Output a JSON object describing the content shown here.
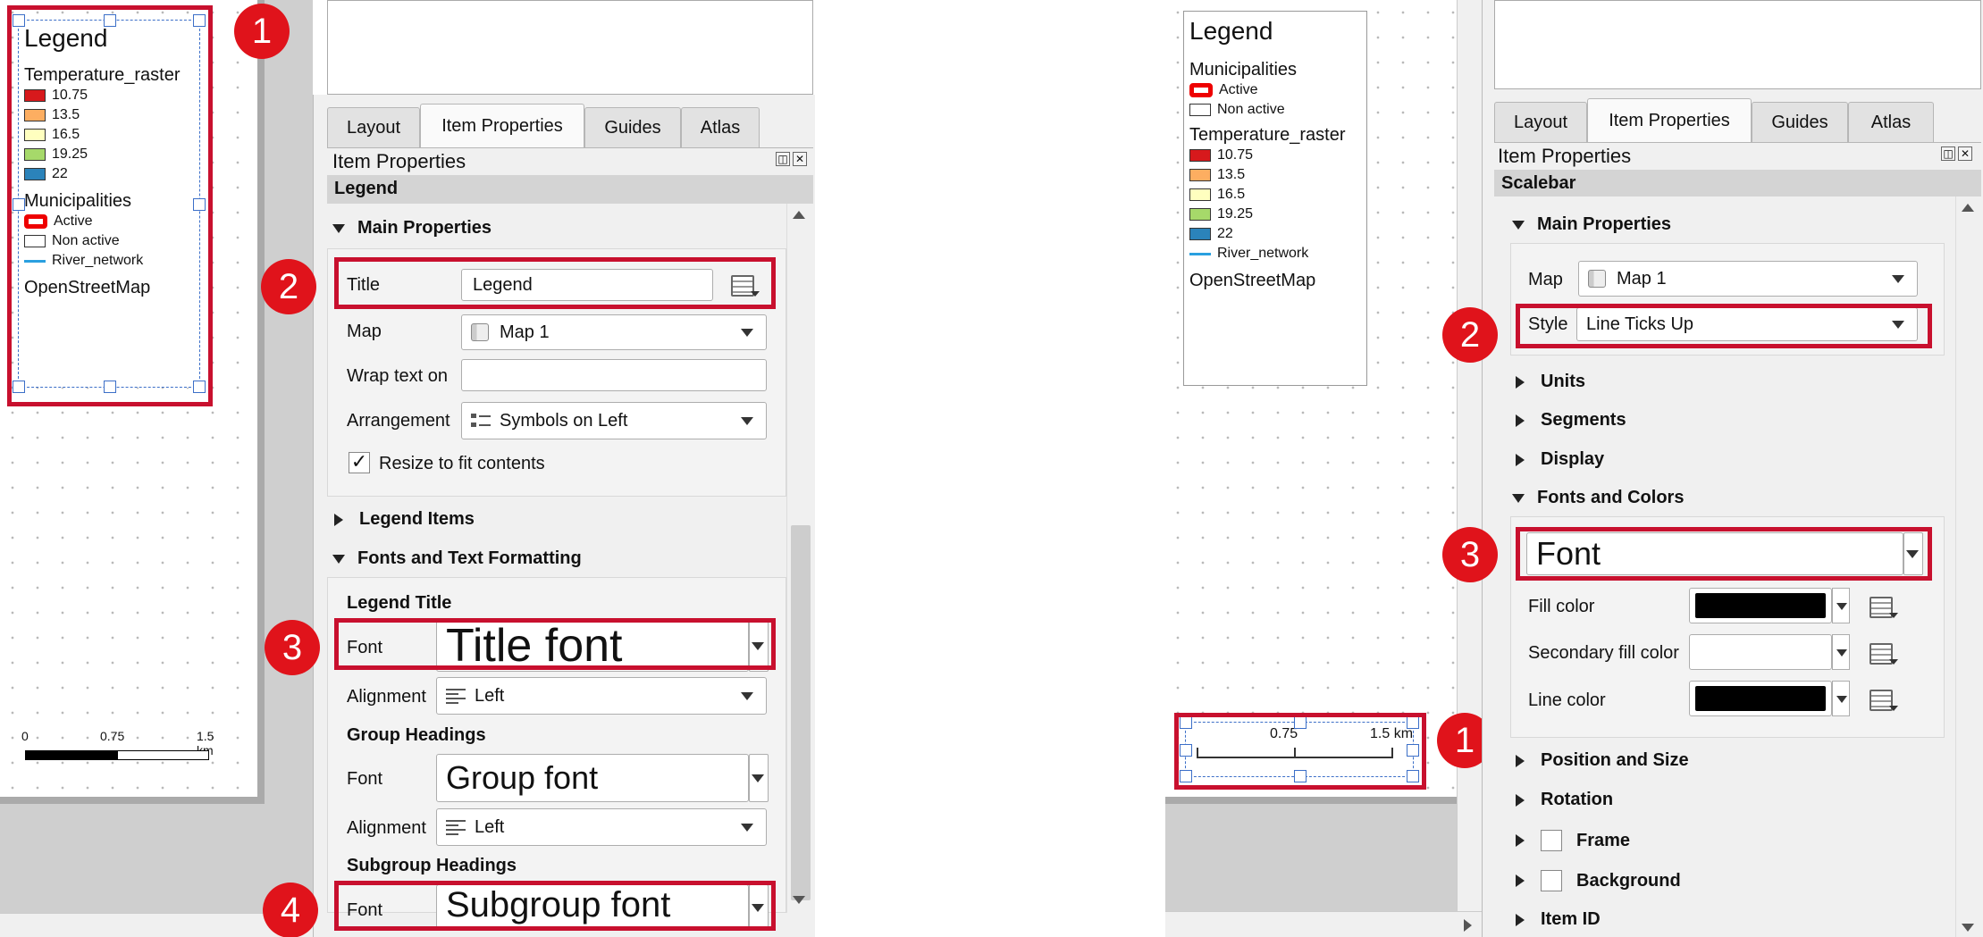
{
  "left": {
    "legend": {
      "title": "Legend",
      "groups": [
        {
          "name": "Temperature_raster",
          "items": [
            {
              "label": "10.75",
              "color": "#d7191c"
            },
            {
              "label": "13.5",
              "color": "#fdae61"
            },
            {
              "label": "16.5",
              "color": "#ffffbf"
            },
            {
              "label": "19.25",
              "color": "#a6d96a"
            },
            {
              "label": "22",
              "color": "#2b83ba"
            }
          ]
        },
        {
          "name": "Municipalities",
          "items": [
            {
              "label": "Active",
              "style": "active"
            },
            {
              "label": "Non active",
              "style": "plain"
            },
            {
              "label": "River_network",
              "style": "line"
            }
          ]
        },
        {
          "name": "OpenStreetMap",
          "items": []
        }
      ]
    },
    "scalebar": {
      "ticks": [
        "0",
        "0.75",
        "1.5 km"
      ]
    },
    "tabs": [
      "Layout",
      "Item Properties",
      "Guides",
      "Atlas"
    ],
    "active_tab": "Item Properties",
    "panel_title": "Item Properties",
    "item_type": "Legend",
    "main_properties": "Main Properties",
    "title_label": "Title",
    "title_value": "Legend",
    "map_label": "Map",
    "map_value": "Map 1",
    "wrap_label": "Wrap text on",
    "wrap_value": "",
    "arrangement_label": "Arrangement",
    "arrangement_value": "Symbols on Left",
    "resize_label": "Resize to fit contents",
    "resize_checked": true,
    "legend_items": "Legend Items",
    "fonts_section": "Fonts and Text Formatting",
    "legend_title_heading": "Legend Title",
    "font_label": "Font",
    "title_font": "Title font",
    "alignment_label": "Alignment",
    "alignment_value": "Left",
    "group_headings": "Group Headings",
    "group_font": "Group font",
    "subgroup_headings": "Subgroup Headings",
    "subgroup_font": "Subgroup font",
    "callouts": [
      "1",
      "2",
      "3",
      "4"
    ]
  },
  "right": {
    "legend": {
      "title": "Legend",
      "groups": [
        {
          "name": "Municipalities",
          "items": [
            {
              "label": "Active",
              "style": "active"
            },
            {
              "label": "Non active",
              "style": "plain"
            }
          ]
        },
        {
          "name": "Temperature_raster",
          "items": [
            {
              "label": "10.75",
              "color": "#d7191c"
            },
            {
              "label": "13.5",
              "color": "#fdae61"
            },
            {
              "label": "16.5",
              "color": "#ffffbf"
            },
            {
              "label": "19.25",
              "color": "#a6d96a"
            },
            {
              "label": "22",
              "color": "#2b83ba"
            },
            {
              "label": "River_network",
              "style": "line"
            }
          ]
        },
        {
          "name": "OpenStreetMap",
          "items": []
        }
      ]
    },
    "scalebar": {
      "ticks": [
        "0.75",
        "1.5 km"
      ]
    },
    "tabs": [
      "Layout",
      "Item Properties",
      "Guides",
      "Atlas"
    ],
    "active_tab": "Item Properties",
    "panel_title": "Item Properties",
    "item_type": "Scalebar",
    "main_properties": "Main Properties",
    "map_label": "Map",
    "map_value": "Map 1",
    "style_label": "Style",
    "style_value": "Line Ticks Up",
    "units": "Units",
    "segments": "Segments",
    "display": "Display",
    "fonts_colors": "Fonts and Colors",
    "font_button": "Font",
    "fill_color_label": "Fill color",
    "fill_color": "#000000",
    "secondary_fill_label": "Secondary fill color",
    "secondary_fill_color": "#ffffff",
    "line_color_label": "Line color",
    "line_color": "#000000",
    "position_size": "Position and Size",
    "rotation": "Rotation",
    "frame": "Frame",
    "background": "Background",
    "item_id": "Item ID",
    "callouts": [
      "1",
      "2",
      "3"
    ]
  },
  "colors": {
    "callout": "#e0131b",
    "highlight_box": "#c8102e",
    "river": "#2aa0e0"
  }
}
